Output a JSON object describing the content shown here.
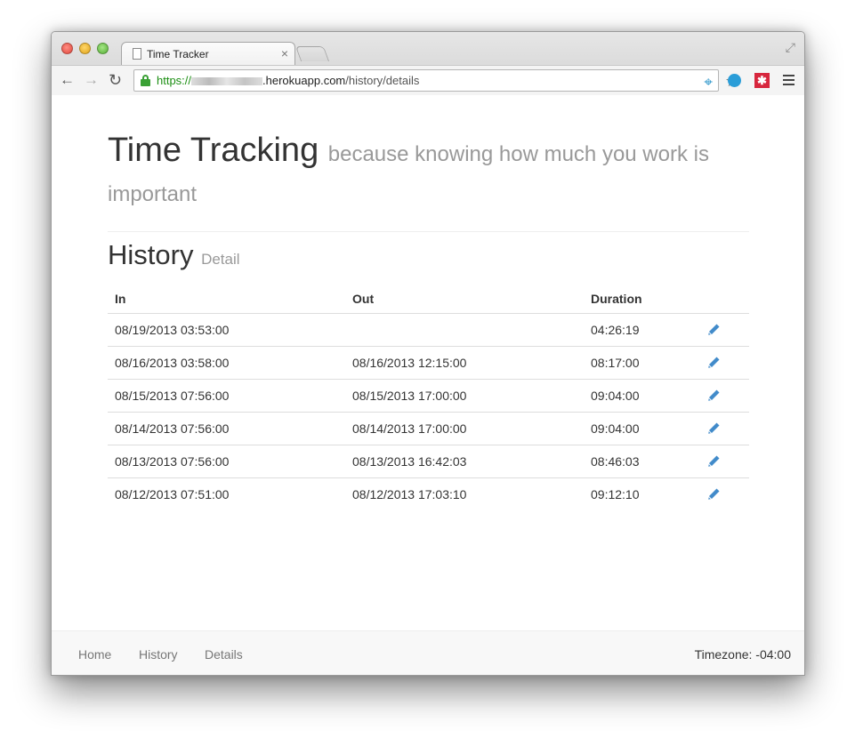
{
  "browser": {
    "tab_title": "Time Tracker",
    "tab_close": "×",
    "url_scheme": "https://",
    "url_host": ".herokuapp.com",
    "url_path": "/history/details"
  },
  "page": {
    "title": "Time Tracking",
    "subtitle": "because knowing how much you work is important",
    "section_title": "History",
    "section_subtitle": "Detail"
  },
  "table": {
    "headers": [
      "In",
      "Out",
      "Duration"
    ],
    "rows": [
      {
        "in": "08/19/2013 03:53:00",
        "out": "",
        "duration": "04:26:19"
      },
      {
        "in": "08/16/2013 03:58:00",
        "out": "08/16/2013 12:15:00",
        "duration": "08:17:00"
      },
      {
        "in": "08/15/2013 07:56:00",
        "out": "08/15/2013 17:00:00",
        "duration": "09:04:00"
      },
      {
        "in": "08/14/2013 07:56:00",
        "out": "08/14/2013 17:00:00",
        "duration": "09:04:00"
      },
      {
        "in": "08/13/2013 07:56:00",
        "out": "08/13/2013 16:42:03",
        "duration": "08:46:03"
      },
      {
        "in": "08/12/2013 07:51:00",
        "out": "08/12/2013 17:03:10",
        "duration": "09:12:10"
      }
    ],
    "edit_icon": "pencil-icon",
    "edit_color": "#428bca"
  },
  "footer": {
    "links": [
      "Home",
      "History",
      "Details"
    ],
    "timezone": "Timezone: -04:00"
  }
}
